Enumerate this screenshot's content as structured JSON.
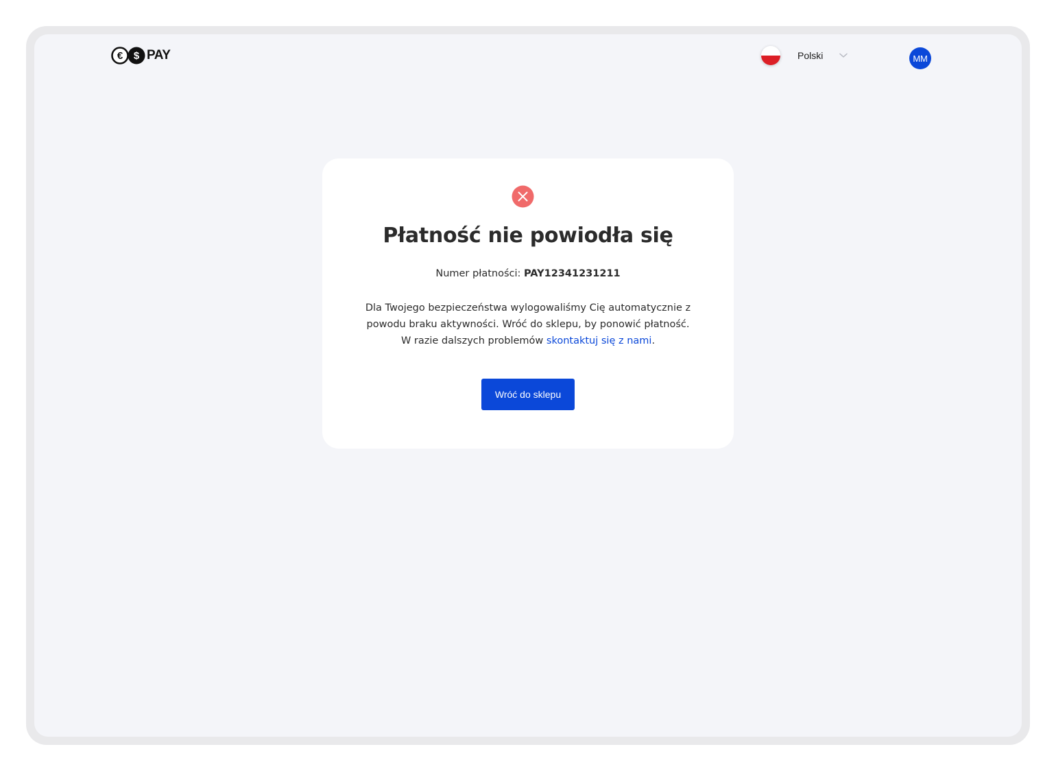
{
  "header": {
    "logo_text": "PAY",
    "language": {
      "label": "Polski",
      "flag_icon": "poland-flag-icon"
    },
    "avatar_initials": "MM"
  },
  "card": {
    "status_icon": "error-x-icon",
    "title": "Płatność nie powiodła się",
    "payment_number_label": "Numer płatności:",
    "payment_number_value": "PAY12341231211",
    "message_line1": "Dla Twojego bezpieczeństwa wylogowaliśmy Cię automatycznie z",
    "message_line2": "powodu braku aktywności. Wróć do sklepu, by ponowić płatność.",
    "message_line3_prefix": "W razie dalszych problemów",
    "contact_link": "skontaktuj się z nami",
    "message_line3_suffix": ".",
    "button_label": "Wróć do sklepu"
  },
  "colors": {
    "brand_blue": "#0b48d9",
    "error_red": "#f06a6a",
    "background": "#f4f5f9"
  }
}
